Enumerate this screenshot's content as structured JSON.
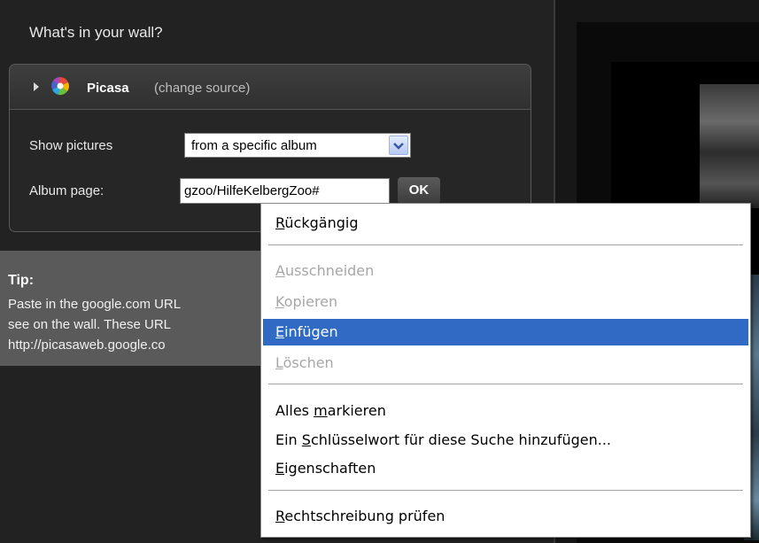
{
  "panel": {
    "title": "What's in your wall?",
    "source": {
      "name": "Picasa",
      "change": "(change source)"
    },
    "show_label": "Show pictures",
    "show_value": "from a specific album",
    "album_label": "Album page:",
    "album_value": "gzoo/HilfeKelbergZoo#",
    "ok": "OK"
  },
  "tip": {
    "title": "Tip:",
    "lines": [
      "Paste in the google.com URL",
      "see on the wall. These URL",
      "http://picasaweb.google.co"
    ]
  },
  "context_menu": {
    "items": [
      {
        "label": "Rückgängig",
        "mnemonic": "R",
        "rest": "ückgängig",
        "state": "enabled"
      },
      {
        "label": "Ausschneiden",
        "mnemonic": "A",
        "rest": "usschneiden",
        "state": "disabled"
      },
      {
        "label": "Kopieren",
        "mnemonic": "K",
        "rest": "opieren",
        "state": "disabled"
      },
      {
        "label": "Einfügen",
        "mnemonic": "E",
        "rest": "infügen",
        "state": "highlighted"
      },
      {
        "label": "Löschen",
        "mnemonic": "L",
        "rest": "öschen",
        "state": "disabled"
      },
      {
        "label": "Alles markieren",
        "pre": "Alles ",
        "mnemonic": "m",
        "rest": "arkieren",
        "state": "enabled"
      },
      {
        "label": "Ein Schlüsselwort für diese Suche hinzufügen...",
        "pre": "Ein ",
        "mnemonic": "S",
        "rest": "chlüsselwort für diese Suche hinzufügen...",
        "state": "enabled"
      },
      {
        "label": "Eigenschaften",
        "mnemonic": "E",
        "rest": "igenschaften",
        "state": "enabled"
      },
      {
        "label": "Rechtschreibung prüfen",
        "mnemonic": "R",
        "rest": "echtschreibung prüfen",
        "state": "enabled"
      }
    ]
  },
  "icons": {
    "expand": "triangle-right-icon",
    "source_logo": "picasa-logo-icon",
    "dropdown": "chevron-down-icon"
  },
  "colors": {
    "highlight": "#316ac5",
    "panel_bg": "#222222",
    "tip_bg": "#5a5a5a"
  }
}
